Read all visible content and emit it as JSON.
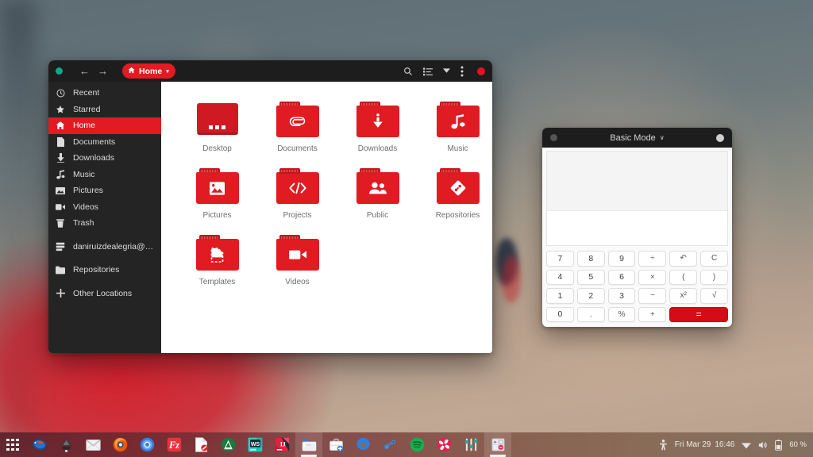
{
  "desktop": {
    "wallpaper_colors": {
      "sky_top": "#5e6d74",
      "warm_mid": "#b49d8c",
      "paint_red": "#cd1e2d",
      "paint_navy": "#11203a"
    }
  },
  "files_window": {
    "titlebar": {
      "status_dot_label": "window-status",
      "back_arrow": "←",
      "forward_arrow": "→",
      "breadcrumb_label": "Home",
      "breadcrumb_caret": "▾",
      "accent": "#e01b22"
    },
    "sidebar": {
      "items": [
        {
          "label": "Recent",
          "icon": "clock-icon",
          "active": false
        },
        {
          "label": "Starred",
          "icon": "star-icon",
          "active": false
        },
        {
          "label": "Home",
          "icon": "home-icon",
          "active": true
        },
        {
          "label": "Documents",
          "icon": "document-icon",
          "active": false
        },
        {
          "label": "Downloads",
          "icon": "download-icon",
          "active": false
        },
        {
          "label": "Music",
          "icon": "music-icon",
          "active": false
        },
        {
          "label": "Pictures",
          "icon": "image-icon",
          "active": false
        },
        {
          "label": "Videos",
          "icon": "video-icon",
          "active": false
        },
        {
          "label": "Trash",
          "icon": "trash-icon",
          "active": false
        },
        {
          "label": "daniruizdealegria@…",
          "icon": "server-icon",
          "active": false
        },
        {
          "label": "Repositories",
          "icon": "folder-icon",
          "active": false
        },
        {
          "label": "Other Locations",
          "icon": "plus-icon",
          "active": false
        }
      ]
    },
    "files": [
      {
        "label": "Desktop",
        "icon": "monitor-icon"
      },
      {
        "label": "Documents",
        "icon": "paperclip-icon"
      },
      {
        "label": "Downloads",
        "icon": "download-arrow-icon"
      },
      {
        "label": "Music",
        "icon": "music-note-icon"
      },
      {
        "label": "Pictures",
        "icon": "photo-icon"
      },
      {
        "label": "Projects",
        "icon": "code-icon"
      },
      {
        "label": "Public",
        "icon": "people-icon"
      },
      {
        "label": "Repositories",
        "icon": "git-icon"
      },
      {
        "label": "Templates",
        "icon": "template-icon"
      },
      {
        "label": "Videos",
        "icon": "camera-icon"
      }
    ]
  },
  "calculator": {
    "title": "Basic Mode",
    "title_caret": "∨",
    "history_value": "",
    "entry_value": "",
    "keys": [
      {
        "label": "7",
        "type": "num"
      },
      {
        "label": "8",
        "type": "num"
      },
      {
        "label": "9",
        "type": "num"
      },
      {
        "label": "÷",
        "type": "op"
      },
      {
        "label": "↶",
        "type": "op"
      },
      {
        "label": "C",
        "type": "op"
      },
      {
        "label": "4",
        "type": "num"
      },
      {
        "label": "5",
        "type": "num"
      },
      {
        "label": "6",
        "type": "num"
      },
      {
        "label": "×",
        "type": "op"
      },
      {
        "label": "(",
        "type": "op"
      },
      {
        "label": ")",
        "type": "op"
      },
      {
        "label": "1",
        "type": "num"
      },
      {
        "label": "2",
        "type": "num"
      },
      {
        "label": "3",
        "type": "num"
      },
      {
        "label": "−",
        "type": "op"
      },
      {
        "label": "x²",
        "type": "op"
      },
      {
        "label": "√",
        "type": "op"
      },
      {
        "label": "0",
        "type": "num"
      },
      {
        "label": ".",
        "type": "num"
      },
      {
        "label": "%",
        "type": "op"
      },
      {
        "label": "+",
        "type": "op"
      },
      {
        "label": "=",
        "type": "equals"
      }
    ],
    "equals_color": "#d40c18"
  },
  "taskbar": {
    "apps_grid_label": "show-applications",
    "apps": [
      {
        "name": "thunderbird",
        "active": false
      },
      {
        "name": "inkscape",
        "active": false
      },
      {
        "name": "mail",
        "active": false
      },
      {
        "name": "firefox",
        "active": false
      },
      {
        "name": "chromium",
        "active": false
      },
      {
        "name": "filezilla",
        "active": false
      },
      {
        "name": "pdf-viewer",
        "active": false
      },
      {
        "name": "android-studio",
        "active": false
      },
      {
        "name": "webstorm",
        "active": false
      },
      {
        "name": "intellij-idea",
        "active": false
      },
      {
        "name": "files",
        "active": true
      },
      {
        "name": "software-center",
        "active": false
      },
      {
        "name": "settings",
        "active": false
      },
      {
        "name": "steam",
        "active": false
      },
      {
        "name": "spotify",
        "active": false
      },
      {
        "name": "pinwheel",
        "active": false
      },
      {
        "name": "equalizer",
        "active": false
      },
      {
        "name": "calculator",
        "active": true
      }
    ],
    "tray": {
      "accessibility_icon": "accessibility-icon",
      "clock_day": "Fri Mar 29",
      "clock_time": "16:46",
      "wifi_icon": "wifi-icon",
      "volume_icon": "volume-icon",
      "battery_icon": "battery-icon",
      "battery_percent": "60 %"
    }
  }
}
